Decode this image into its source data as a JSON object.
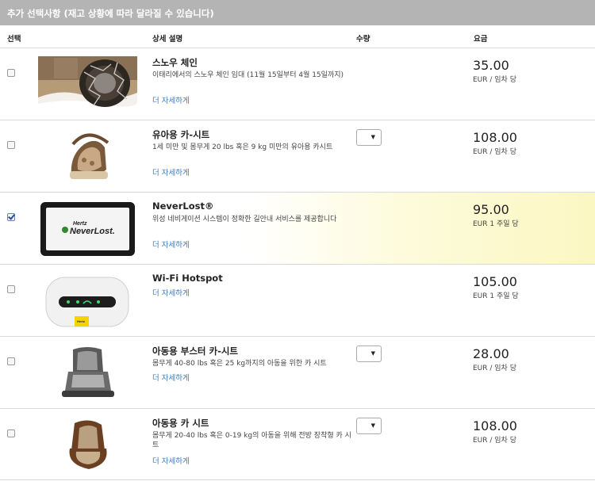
{
  "section_title": "추가 선택사항 (재고 상황에 따라 달라질 수 있습니다)",
  "columns": {
    "select": "선택",
    "description": "상세 설명",
    "quantity": "수량",
    "price": "요금"
  },
  "items": [
    {
      "title": "스노우 체인",
      "description": "이태리에서의 스노우 체인 임대 (11월 15일부터 4월 15일까지)",
      "more": "더 자세하게",
      "price": "35.00",
      "unit": "EUR / 임차 당",
      "checked": false,
      "has_qty": false,
      "icon": "snow-chain-tire-image"
    },
    {
      "title": "유아용 카-시트",
      "description": "1세 미만 및 몸무게 20 lbs 혹은 9 kg 미만의 유아용 카시트",
      "more": "더 자세하게",
      "price": "108.00",
      "unit": "EUR / 임차 당",
      "checked": false,
      "has_qty": true,
      "icon": "infant-car-seat-image"
    },
    {
      "title": "NeverLost®",
      "description": "위성 네비게이션 시스템이 정확한 길안내 서비스를 제공합니다",
      "more": "더 자세하게",
      "price": "95.00",
      "unit": "EUR 1 주일 당",
      "checked": true,
      "has_qty": false,
      "icon": "gps-device-image"
    },
    {
      "title": "Wi-Fi Hotspot",
      "description": "",
      "more": "더 자세하게",
      "price": "105.00",
      "unit": "EUR 1 주일 당",
      "checked": false,
      "has_qty": false,
      "icon": "wifi-hotspot-device-image"
    },
    {
      "title": "아동용 부스터 카-시트",
      "description": "몸무게 40-80 lbs 혹은 25 kg까지의 아동을 위한 카 시트",
      "more": "더 자세하게",
      "price": "28.00",
      "unit": "EUR / 임차 당",
      "checked": false,
      "has_qty": true,
      "icon": "booster-seat-image"
    },
    {
      "title": "아동용 카 시트",
      "description": "몸무게 20-40 lbs 혹은 0-19 kg의 아동을 위해 전방 장착형 카 시트",
      "more": "더 자세하게",
      "price": "108.00",
      "unit": "EUR / 임차 당",
      "checked": false,
      "has_qty": true,
      "icon": "child-car-seat-image"
    }
  ],
  "gps_logo": {
    "brand": "Hertz",
    "product": "NeverLost."
  },
  "hotspot_label": "Hertz",
  "colors": {
    "header_bg": "#b4b4b4",
    "link": "#3b7bbf",
    "selected_highlight": "#fbf7c2"
  }
}
